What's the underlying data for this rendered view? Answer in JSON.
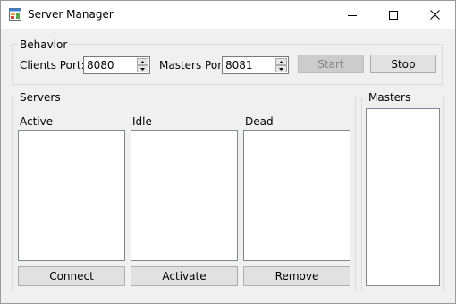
{
  "window": {
    "title": "Server Manager",
    "app_icon": "windows-forms-app-icon",
    "controls": [
      "minimize-icon",
      "maximize-icon",
      "close-icon"
    ]
  },
  "behavior": {
    "group_label": "Behavior",
    "clients_port_label": "Clients Port:",
    "clients_port_value": "8080",
    "masters_port_label": "Masters Port:",
    "masters_port_value": "8081",
    "start_label": "Start",
    "start_enabled": false,
    "stop_label": "Stop"
  },
  "servers": {
    "group_label": "Servers",
    "active_label": "Active",
    "idle_label": "Idle",
    "dead_label": "Dead",
    "active_items": [],
    "idle_items": [],
    "dead_items": [],
    "connect_label": "Connect",
    "activate_label": "Activate",
    "remove_label": "Remove"
  },
  "masters": {
    "group_label": "Masters",
    "items": []
  },
  "colors": {
    "titlebar": "#ffffff",
    "window_bg": "#f0f0f0",
    "button_bg": "#e1e1e1",
    "disabled_button_bg": "#cccccc",
    "disabled_text": "#838383",
    "group_border": "#dcdcdc",
    "listbox_border": "#828790"
  }
}
